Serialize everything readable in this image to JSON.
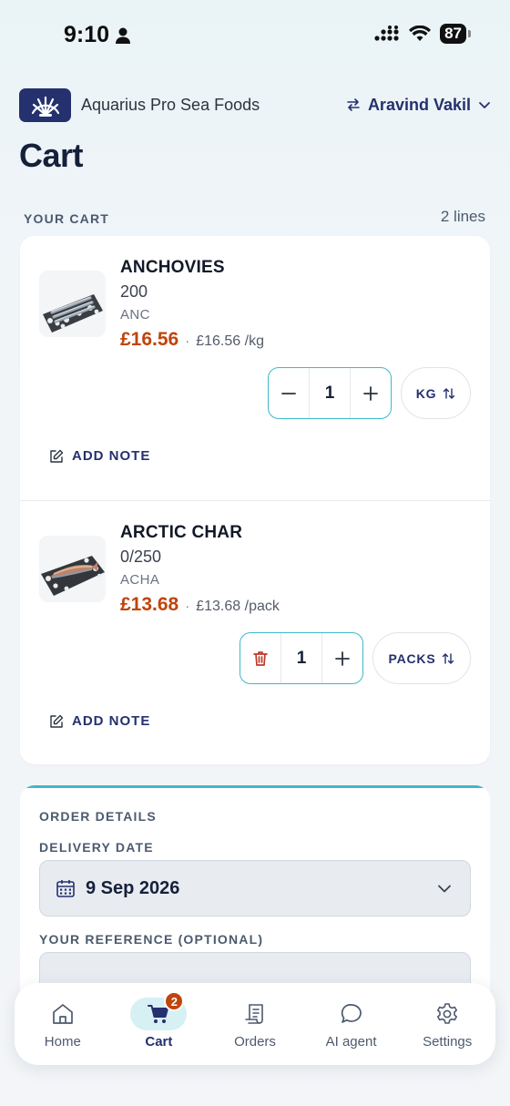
{
  "status_bar": {
    "time": "9:10",
    "battery": "87"
  },
  "header": {
    "brand_name": "Aquarius Pro Sea Foods",
    "user_name": "Aravind Vakil"
  },
  "page": {
    "title": "Cart"
  },
  "cart": {
    "section_label": "YOUR CART",
    "line_count": "2 lines",
    "items": [
      {
        "name": "ANCHOVIES",
        "size": "200",
        "code": "ANC",
        "price": "£16.56",
        "separator": "·",
        "unit_price": "£16.56 /kg",
        "quantity": "1",
        "unit": "KG",
        "note_label": "ADD NOTE"
      },
      {
        "name": "ARCTIC CHAR",
        "size": "0/250",
        "code": "ACHA",
        "price": "£13.68",
        "separator": "·",
        "unit_price": "£13.68 /pack",
        "quantity": "1",
        "unit": "PACKS",
        "note_label": "ADD NOTE"
      }
    ]
  },
  "order_details": {
    "title": "ORDER DETAILS",
    "delivery_label": "DELIVERY DATE",
    "delivery_date": "9 Sep 2026",
    "reference_label": "YOUR REFERENCE (OPTIONAL)",
    "reference_value": ""
  },
  "nav": {
    "items": [
      {
        "label": "Home",
        "icon": "home-icon"
      },
      {
        "label": "Cart",
        "icon": "cart-icon",
        "badge": "2",
        "active": true
      },
      {
        "label": "Orders",
        "icon": "orders-icon"
      },
      {
        "label": "AI agent",
        "icon": "chat-icon"
      },
      {
        "label": "Settings",
        "icon": "gear-icon"
      }
    ]
  },
  "colors": {
    "brand": "#25306e",
    "accent": "#3fb8c9",
    "price": "#c0440c",
    "delete": "#c0392b"
  }
}
